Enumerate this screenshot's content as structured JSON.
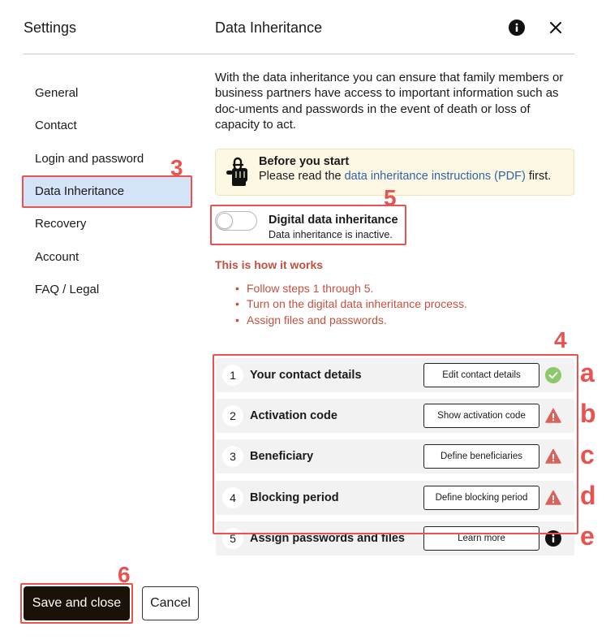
{
  "header": {
    "settings_title": "Settings",
    "section_title": "Data Inheritance"
  },
  "sidebar": {
    "items": [
      {
        "label": "General"
      },
      {
        "label": "Contact"
      },
      {
        "label": "Login and password"
      },
      {
        "label": "Data Inheritance"
      },
      {
        "label": "Recovery"
      },
      {
        "label": "Account"
      },
      {
        "label": "FAQ / Legal"
      }
    ],
    "active_index": 3
  },
  "intro": "With the data inheritance you can ensure that family members or business partners have access to important information such as doc-uments and passwords in the event of death or loss of capacity to act.",
  "notice": {
    "title": "Before you start",
    "text_before": "Please read the ",
    "link": "data inheritance instructions (PDF)",
    "text_after": " first.",
    "icon": "hand-pointer-icon"
  },
  "toggle": {
    "title": "Digital data inheritance",
    "status": "Data inheritance is inactive.",
    "on": false
  },
  "how": {
    "title": "This is how it works",
    "items": [
      "Follow steps 1 through 5.",
      "Turn on the digital data inheritance process.",
      "Assign files and passwords."
    ]
  },
  "steps": [
    {
      "number": "1",
      "label": "Your contact details",
      "button": "Edit contact details",
      "status": "done"
    },
    {
      "number": "2",
      "label": "Activation code",
      "button": "Show activation code",
      "status": "warning"
    },
    {
      "number": "3",
      "label": "Beneficiary",
      "button": "Define beneficiaries",
      "status": "warning"
    },
    {
      "number": "4",
      "label": "Blocking period",
      "button": "Define blocking period",
      "status": "warning"
    },
    {
      "number": "5",
      "label": "Assign passwords and files",
      "button": "Learn more",
      "status": "info"
    }
  ],
  "footer": {
    "save_label": "Save and close",
    "cancel_label": "Cancel"
  },
  "callouts": {
    "n3": "3",
    "n4": "4",
    "n5": "5",
    "n6": "6",
    "letters": [
      "a",
      "b",
      "c",
      "d",
      "e"
    ]
  },
  "colors": {
    "callout": "#e8524f",
    "active_nav": "#d4e3f7",
    "how_text": "#c4503f",
    "link": "#2f64a6",
    "done": "#8cc96a",
    "warning": "#d9625a"
  }
}
